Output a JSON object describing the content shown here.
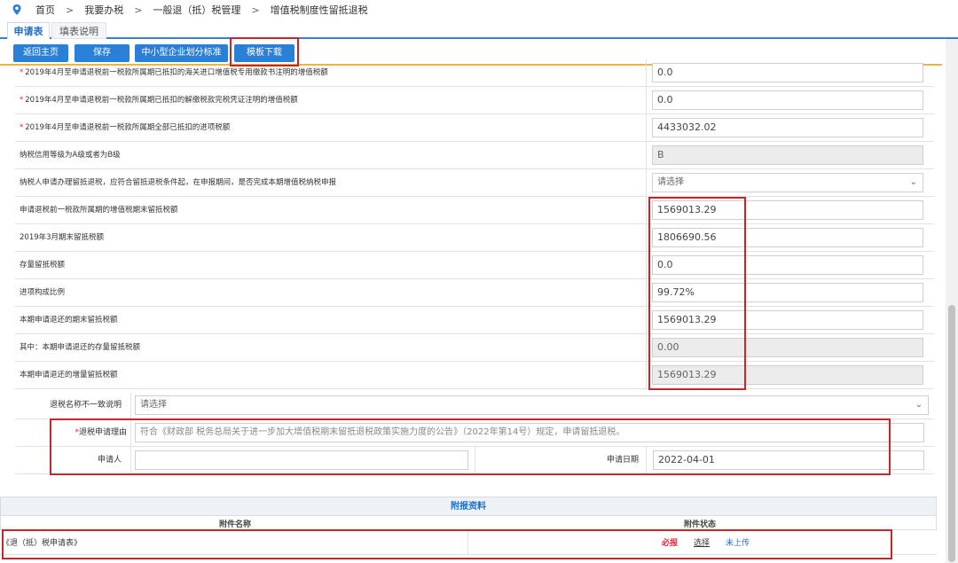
{
  "breadcrumb": [
    "首页",
    "我要办税",
    "一般退（抵）税管理",
    "增值税制度性留抵退税"
  ],
  "tabs": [
    "申请表",
    "填表说明"
  ],
  "toolbar": {
    "home": "返回主页",
    "save": "保存",
    "std": "中小型企业划分标准",
    "template": "模板下载"
  },
  "rows": [
    {
      "label": "2019年4月至申请退税前一税款所属期已抵扣的海关进口增值税专用缴款书注明的增值税额",
      "required": "*",
      "value": "0.0",
      "kind": "input"
    },
    {
      "label": "2019年4月至申请退税前一税款所属期已抵扣的解缴税款完税凭证注明的增值税额",
      "required": "*",
      "value": "0.0",
      "kind": "input"
    },
    {
      "label": "2019年4月至申请退税前一税款所属期全部已抵扣的进项税额",
      "required": "*",
      "value": "4433032.02",
      "kind": "input"
    },
    {
      "label": "纳税信用等级为A级或者为B级",
      "required": "",
      "value": "B",
      "kind": "ro"
    },
    {
      "label": "纳税人申请办理留抵退税，应符合留抵退税条件起，在申报期间，是否完成本期增值税纳税申报",
      "required": "",
      "value": "请选择",
      "kind": "select"
    },
    {
      "label": "申请退税前一税款所属期的增值税期末留抵税额",
      "required": "",
      "value": "1569013.29",
      "kind": "input"
    },
    {
      "label": "2019年3月期末留抵税额",
      "required": "",
      "value": "1806690.56",
      "kind": "input"
    },
    {
      "label": "存量留抵税额",
      "required": "",
      "value": "0.0",
      "kind": "input"
    },
    {
      "label": "进项构成比例",
      "required": "",
      "value": "99.72%",
      "kind": "input"
    },
    {
      "label": "本期申请退还的期末留抵税额",
      "required": "",
      "value": "1569013.29",
      "kind": "input"
    },
    {
      "label": "其中：本期申请退还的存量留抵税额",
      "required": "",
      "value": "0.00",
      "kind": "ro"
    },
    {
      "label": "本期申请退还的增量留抵税额",
      "required": "",
      "value": "1569013.29",
      "kind": "ro"
    }
  ],
  "mismatch": {
    "label": "退税名称不一致说明",
    "value": "请选择"
  },
  "reason": {
    "required": "*",
    "label": "退税申请理由",
    "placeholder": "符合《财政部 税务总局关于进一步加大增值税期末留抵退税政策实施力度的公告》（2022年第14号）规定，申请留抵退税。"
  },
  "applicant": {
    "label": "申请人",
    "value": "",
    "date_label": "申请日期",
    "date": "2022-04-01"
  },
  "attachments": {
    "title": "附报资料",
    "col_name": "附件名称",
    "col_status": "附件状态",
    "items": [
      {
        "name": "《退（抵）税申请表》",
        "required": "必报",
        "choose": "选择",
        "status": "未上传"
      }
    ]
  },
  "colors": {
    "accent": "#2a7fd6",
    "highlight": "#c1272d",
    "required": "#e23"
  }
}
